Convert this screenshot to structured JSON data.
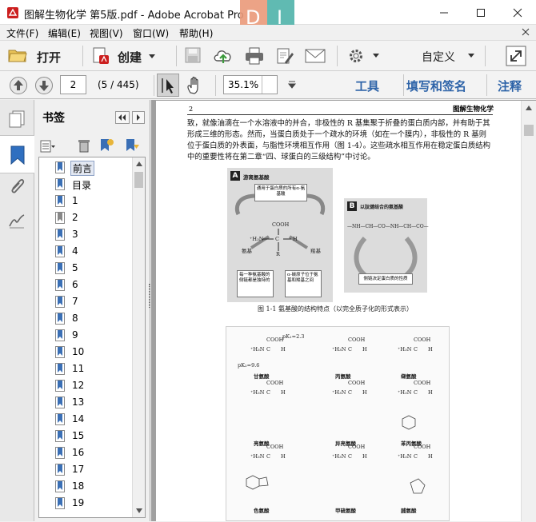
{
  "window": {
    "title": "图解生物化学 第5版.pdf - Adobe Acrobat Pro",
    "minimize_icon": "minimize-icon",
    "maximize_icon": "maximize-icon",
    "close_icon": "close-icon"
  },
  "menu": [
    "文件(F)",
    "编辑(E)",
    "视图(V)",
    "窗口(W)",
    "帮助(H)"
  ],
  "toolbar": {
    "open_label": "打开",
    "create_label": "创建",
    "customize_label": "自定义"
  },
  "nav": {
    "current_page": "2",
    "page_count": "(5 / 445)",
    "zoom": "35.1%",
    "tools_label": "工具",
    "fill_sign_label": "填写和签名",
    "comment_label": "注释"
  },
  "sidebar": {
    "panel_title": "书签",
    "bookmarks": [
      "前言",
      "目录",
      "1",
      "2",
      "3",
      "4",
      "5",
      "6",
      "7",
      "8",
      "9",
      "10",
      "11",
      "12",
      "13",
      "14",
      "15",
      "16",
      "17",
      "18",
      "19"
    ],
    "selected_index": 0
  },
  "document": {
    "page_number": "2",
    "running_header": "图解生物化学",
    "paragraph": "致，就像油滴在一个水溶液中的并合，非极性的 R 基集聚于折叠的蛋白质内部，并有助于其形成三维的形态。然而，当蛋白质处于一个疏水的环境（如在一个膜内），非极性的 R 基则位于蛋白质的外表面，与脂性环境相互作用（图 1-4）。这些疏水相互作用在稳定蛋白质结构中的重要性将在第二章“四、球蛋白的三级结构”中讨论。",
    "figA": {
      "letter": "A",
      "title": "游离氨基酸",
      "note_top": "通用于蛋白质的所有α-氨基酸",
      "cooh": "COOH",
      "nh2": "⁺H₃N",
      "c": "C",
      "h": "H",
      "r": "R",
      "amino_label": "氨基",
      "carboxyl_label": "羧基",
      "note_left": "每一种氨基酸的侧链都是独特的",
      "note_right": "α-碳原子位于氨基和羧基之间"
    },
    "figB": {
      "letter": "B",
      "title": "以肽键结合的氨基酸",
      "chain": "—NH—CH—CO—NH—CH—CO—",
      "note": "侧链决定蛋白质的性质"
    },
    "figure_caption": "图 1-1   氨基酸的结构特点（以完全质子化的形式表示）",
    "amino_acids": [
      "甘氨酸",
      "丙氨酸",
      "缬氨酸",
      "亮氨酸",
      "异亮氨酸",
      "苯丙氨酸",
      "色氨酸",
      "甲硫氨酸",
      "脯氨酸"
    ],
    "pk1": "pK₁=2.3",
    "pk2": "pK₂=9.6",
    "cooh": "COOH",
    "nh3": "⁺H₃N",
    "h": "H"
  },
  "colors": {
    "accent_blue": "#2d63a8",
    "adobe_red": "#cc1f1f",
    "bookmark_icon": "#3a6fb5"
  }
}
